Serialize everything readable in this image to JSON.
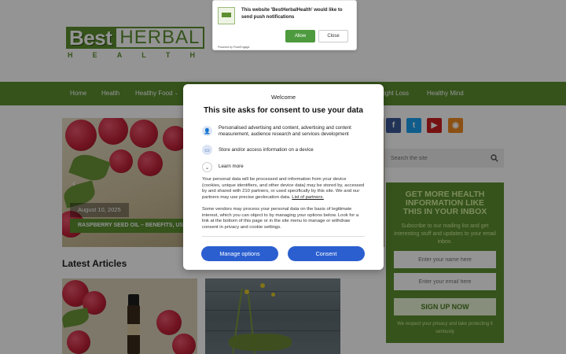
{
  "logo": {
    "best": "Best",
    "herbal": "HERBAL",
    "health_letters": [
      "H",
      "E",
      "A",
      "L",
      "T",
      "H"
    ]
  },
  "push_prompt": {
    "message": "This website 'BestHerbalHealth' would like to send push notifications",
    "allow_label": "Allow",
    "close_label": "Close",
    "powered_by": "Powered by PushEngage"
  },
  "nav": {
    "items": [
      "Home",
      "Health",
      "Healthy Food",
      "ight Loss",
      "Healthy Mind"
    ]
  },
  "slider": {
    "date": "August 10, 2025",
    "title": "RASPBERRY SEED OIL – BENEFITS, USE"
  },
  "latest_heading": "Latest Articles",
  "sidebar": {
    "social": [
      "facebook-icon",
      "twitter-icon",
      "youtube-icon",
      "rss-icon"
    ],
    "search_placeholder": "Search the site",
    "newsletter": {
      "title": "GET MORE HEALTH INFORMATION LIKE THIS IN YOUR INBOX",
      "description": "Subscribe to our mailing list and get interesting stuff and updates to your email inbox.",
      "name_placeholder": "Enter your name here",
      "email_placeholder": "Enter your email here",
      "button_label": "SIGN UP NOW",
      "privacy_note": "We respect your privacy and take protecting it seriously"
    }
  },
  "consent": {
    "welcome": "Welcome",
    "title": "This site asks for consent to use your data",
    "purposes": [
      "Personalised advertising and content, advertising and content measurement, audience research and services development",
      "Store and/or access information on a device",
      "Learn more"
    ],
    "body1": "Your personal data will be processed and information from your device (cookies, unique identifiers, and other device data) may be stored by, accessed by and shared with 210 partners, or used specifically by this site. We and our partners may use precise geolocation data.",
    "partners_link": "List of partners.",
    "body2": "Some vendors may process your personal data on the basis of legitimate interest, which you can object to by managing your options below. Look for a link at the bottom of this page or in the site menu to manage or withdraw consent in privacy and cookie settings.",
    "manage_label": "Manage options",
    "consent_label": "Consent"
  },
  "colors": {
    "brand_green": "#5c8f2f",
    "consent_blue": "#2b5fd0"
  }
}
